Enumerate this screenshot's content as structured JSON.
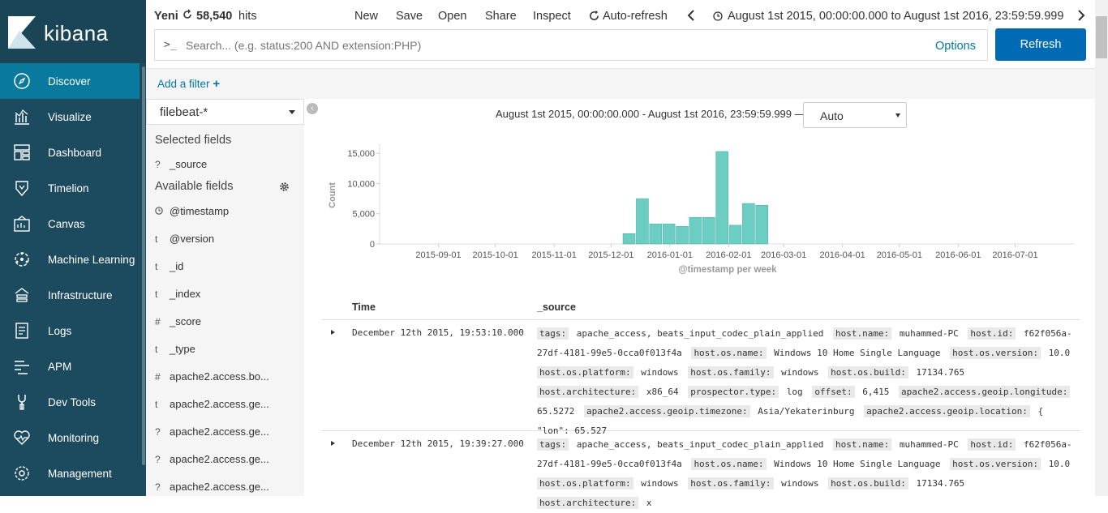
{
  "sidebar": {
    "logo": "kibana",
    "items": [
      {
        "label": "Discover",
        "icon": "compass-icon"
      },
      {
        "label": "Visualize",
        "icon": "chart-icon"
      },
      {
        "label": "Dashboard",
        "icon": "dashboard-icon"
      },
      {
        "label": "Timelion",
        "icon": "shield-icon"
      },
      {
        "label": "Canvas",
        "icon": "canvas-icon"
      },
      {
        "label": "Machine Learning",
        "icon": "ml-icon"
      },
      {
        "label": "Infrastructure",
        "icon": "infrastructure-icon"
      },
      {
        "label": "Logs",
        "icon": "logs-icon"
      },
      {
        "label": "APM",
        "icon": "apm-icon"
      },
      {
        "label": "Dev Tools",
        "icon": "wrench-icon"
      },
      {
        "label": "Monitoring",
        "icon": "heartbeat-icon"
      },
      {
        "label": "Management",
        "icon": "gear-icon"
      }
    ]
  },
  "topbar": {
    "title": "Yeni",
    "hits_count": "58,540",
    "hits_label": "hits",
    "menu": {
      "new": "New",
      "save": "Save",
      "open": "Open",
      "share": "Share",
      "inspect": "Inspect",
      "auto_refresh": "Auto-refresh"
    },
    "time_range": "August 1st 2015, 00:00:00.000 to August 1st 2016, 23:59:59.999"
  },
  "query": {
    "prompt": ">_",
    "placeholder": "Search... (e.g. status:200 AND extension:PHP)",
    "options": "Options",
    "refresh": "Refresh"
  },
  "filter": {
    "add": "Add a filter"
  },
  "fields_panel": {
    "index_pattern": "filebeat-*",
    "selected_title": "Selected fields",
    "selected": [
      {
        "type": "?",
        "name": "_source"
      }
    ],
    "available_title": "Available fields",
    "available": [
      {
        "type": "clock",
        "name": "@timestamp"
      },
      {
        "type": "t",
        "name": "@version"
      },
      {
        "type": "t",
        "name": "_id"
      },
      {
        "type": "t",
        "name": "_index"
      },
      {
        "type": "#",
        "name": "_score"
      },
      {
        "type": "t",
        "name": "_type"
      },
      {
        "type": "#",
        "name": "apache2.access.bo..."
      },
      {
        "type": "t",
        "name": "apache2.access.ge..."
      },
      {
        "type": "?",
        "name": "apache2.access.ge..."
      },
      {
        "type": "?",
        "name": "apache2.access.ge..."
      },
      {
        "type": "?",
        "name": "apache2.access.ge..."
      }
    ]
  },
  "histogram": {
    "range_label": "August 1st 2015, 00:00:00.000 - August 1st 2016, 23:59:59.999 —",
    "interval": "Auto"
  },
  "chart_data": {
    "type": "bar",
    "xlabel": "@timestamp per week",
    "ylabel": "Count",
    "ylim": [
      0,
      16500
    ],
    "yticks": [
      0,
      5000,
      10000,
      15000
    ],
    "ytick_labels": [
      "0",
      "5,000",
      "10,000",
      "15,000"
    ],
    "xticks": [
      "2015-09-01",
      "2015-10-01",
      "2015-11-01",
      "2015-12-01",
      "2016-01-01",
      "2016-02-01",
      "2016-03-01",
      "2016-04-01",
      "2016-05-01",
      "2016-06-01",
      "2016-07-01"
    ],
    "xlim": [
      "2015-08-01",
      "2016-08-01"
    ],
    "color": "#6ccdc3",
    "weeks": [
      "2015-12-07",
      "2015-12-14",
      "2015-12-21",
      "2015-12-28",
      "2016-01-04",
      "2016-01-11",
      "2016-01-18",
      "2016-01-25",
      "2016-02-01",
      "2016-02-08",
      "2016-02-15"
    ],
    "values": [
      1700,
      7500,
      3300,
      3300,
      2900,
      4400,
      4400,
      15300,
      3100,
      6700,
      6400
    ]
  },
  "documents": {
    "headers": {
      "time": "Time",
      "source": "_source"
    },
    "rows": [
      {
        "time": "December 12th 2015, 19:53:10.000",
        "fields": [
          [
            "tags:",
            "apache_access, beats_input_codec_plain_applied"
          ],
          [
            "host.name:",
            "muhammed-PC"
          ],
          [
            "host.id:",
            "f62f056a-27df-4181-99e5-0cca0f013f4a"
          ],
          [
            "host.os.name:",
            "Windows 10 Home Single Language"
          ],
          [
            "host.os.version:",
            "10.0"
          ],
          [
            "host.os.platform:",
            "windows"
          ],
          [
            "host.os.family:",
            "windows"
          ],
          [
            "host.os.build:",
            "17134.765"
          ],
          [
            "host.architecture:",
            "x86_64"
          ],
          [
            "prospector.type:",
            "log"
          ],
          [
            "offset:",
            "6,415"
          ],
          [
            "apache2.access.geoip.longitude:",
            "65.5272"
          ],
          [
            "apache2.access.geoip.timezone:",
            "Asia/Yekaterinburg"
          ],
          [
            "apache2.access.geoip.location:",
            "{ \"lon\": 65.527"
          ]
        ]
      },
      {
        "time": "December 12th 2015, 19:39:27.000",
        "fields": [
          [
            "tags:",
            "apache_access, beats_input_codec_plain_applied"
          ],
          [
            "host.name:",
            "muhammed-PC"
          ],
          [
            "host.id:",
            "f62f056a-27df-4181-99e5-0cca0f013f4a"
          ],
          [
            "host.os.name:",
            "Windows 10 Home Single Language"
          ],
          [
            "host.os.version:",
            "10.0"
          ],
          [
            "host.os.platform:",
            "windows"
          ],
          [
            "host.os.family:",
            "windows"
          ],
          [
            "host.os.build:",
            "17134.765"
          ],
          [
            "host.architecture:",
            "x"
          ]
        ]
      }
    ]
  }
}
